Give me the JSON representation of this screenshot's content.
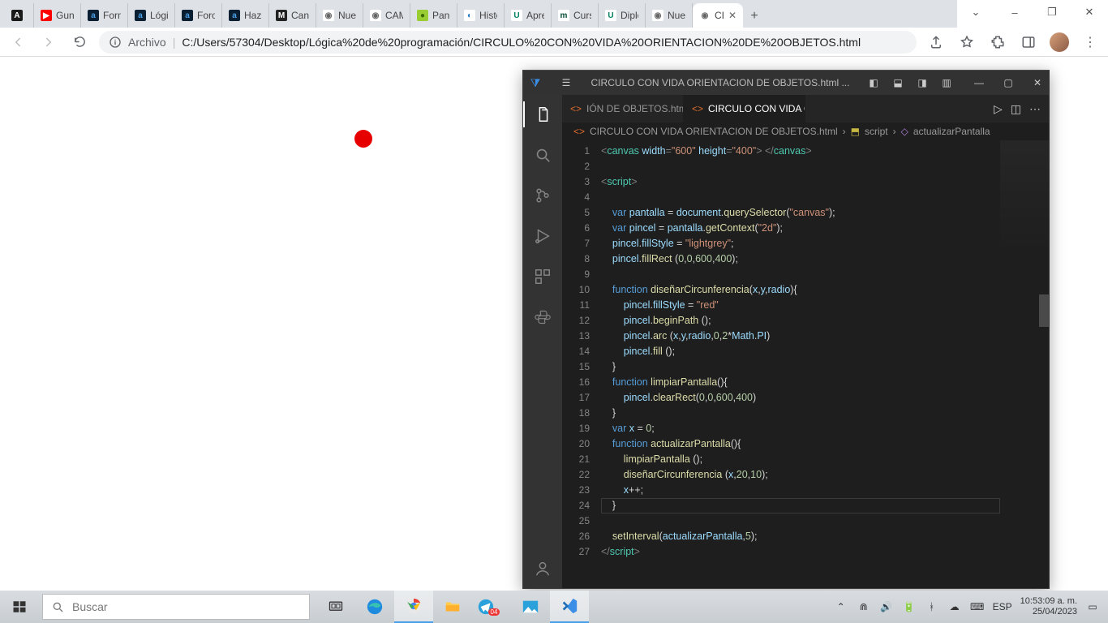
{
  "os_window": {
    "minimize": "–",
    "maximize": "❐",
    "close": "✕"
  },
  "chrome": {
    "tabs": [
      {
        "label": "",
        "favicon_bg": "#1a1a1a",
        "favicon_fg": "#fff",
        "favicon_text": "A"
      },
      {
        "label": "Guns",
        "favicon_bg": "#ff0000",
        "favicon_fg": "#fff",
        "favicon_text": "▶"
      },
      {
        "label": "Form",
        "favicon_bg": "#0b1f33",
        "favicon_fg": "#4aa0e8",
        "favicon_text": "a"
      },
      {
        "label": "Lógic",
        "favicon_bg": "#0b1f33",
        "favicon_fg": "#4aa0e8",
        "favicon_text": "a"
      },
      {
        "label": "Foro",
        "favicon_bg": "#0b1f33",
        "favicon_fg": "#4aa0e8",
        "favicon_text": "a"
      },
      {
        "label": "Haz l",
        "favicon_bg": "#0b1f33",
        "favicon_fg": "#4aa0e8",
        "favicon_text": "a"
      },
      {
        "label": "Canv",
        "favicon_bg": "#222",
        "favicon_fg": "#fff",
        "favicon_text": "M"
      },
      {
        "label": "Nuev",
        "favicon_bg": "#fff",
        "favicon_fg": "#666",
        "favicon_text": "◉"
      },
      {
        "label": "CAM",
        "favicon_bg": "#fff",
        "favicon_fg": "#666",
        "favicon_text": "◉"
      },
      {
        "label": "Pane",
        "favicon_bg": "#9acd32",
        "favicon_fg": "#3a6b00",
        "favicon_text": "●"
      },
      {
        "label": "Histo",
        "favicon_bg": "#fff",
        "favicon_fg": "#1e73be",
        "favicon_text": "◐"
      },
      {
        "label": "Apre",
        "favicon_bg": "#fff",
        "favicon_fg": "#008060",
        "favicon_text": "U"
      },
      {
        "label": "Curs",
        "favicon_bg": "#fff",
        "favicon_fg": "#0b4f3a",
        "favicon_text": "m"
      },
      {
        "label": "Diplo",
        "favicon_bg": "#fff",
        "favicon_fg": "#008060",
        "favicon_text": "U"
      },
      {
        "label": "Nuev",
        "favicon_bg": "#fff",
        "favicon_fg": "#666",
        "favicon_text": "◉"
      },
      {
        "label": "CI",
        "favicon_bg": "#fff",
        "favicon_fg": "#666",
        "favicon_text": "◉",
        "active": true
      }
    ],
    "newtab": "+",
    "toolbar": {
      "file_label": "Archivo",
      "url": "C:/Users/57304/Desktop/Lógica%20de%20programación/CIRCULO%20CON%20VIDA%20ORIENTACION%20DE%20OBJETOS.html"
    }
  },
  "vscode": {
    "title": "CIRCULO CON VIDA ORIENTACION DE OBJETOS.html ...",
    "tabs": [
      {
        "label": "IÓN DE OBJETOS.html",
        "active": false
      },
      {
        "label": "CIRCULO CON VIDA ORIENTACION DE OBJETOS.html",
        "active": true
      }
    ],
    "breadcrumb": {
      "file": "CIRCULO CON VIDA ORIENTACION DE OBJETOS.html",
      "scope1": "script",
      "scope2": "actualizarPantalla"
    },
    "line_start": 1,
    "line_end": 27
  },
  "code_tokens": [
    [
      [
        "t-punc",
        "<"
      ],
      [
        "t-tag",
        "canvas"
      ],
      [
        "t-id",
        " "
      ],
      [
        "t-attr",
        "width"
      ],
      [
        "t-punc",
        "="
      ],
      [
        "t-str",
        "\"600\""
      ],
      [
        "t-id",
        " "
      ],
      [
        "t-attr",
        "height"
      ],
      [
        "t-punc",
        "="
      ],
      [
        "t-str",
        "\"400\""
      ],
      [
        "t-punc",
        "> </"
      ],
      [
        "t-tag",
        "canvas"
      ],
      [
        "t-punc",
        ">"
      ]
    ],
    [],
    [
      [
        "t-punc",
        "<"
      ],
      [
        "t-tag",
        "script"
      ],
      [
        "t-punc",
        ">"
      ]
    ],
    [],
    [
      [
        "t-id",
        "    "
      ],
      [
        "t-kw",
        "var"
      ],
      [
        "t-id",
        " "
      ],
      [
        "t-var",
        "pantalla"
      ],
      [
        "t-id",
        " = "
      ],
      [
        "t-var",
        "document"
      ],
      [
        "t-id",
        "."
      ],
      [
        "t-fn",
        "querySelector"
      ],
      [
        "t-id",
        "("
      ],
      [
        "t-str",
        "\"canvas\""
      ],
      [
        "t-id",
        ");"
      ]
    ],
    [
      [
        "t-id",
        "    "
      ],
      [
        "t-kw",
        "var"
      ],
      [
        "t-id",
        " "
      ],
      [
        "t-var",
        "pincel"
      ],
      [
        "t-id",
        " = "
      ],
      [
        "t-var",
        "pantalla"
      ],
      [
        "t-id",
        "."
      ],
      [
        "t-fn",
        "getContext"
      ],
      [
        "t-id",
        "("
      ],
      [
        "t-str",
        "\"2d\""
      ],
      [
        "t-id",
        ");"
      ]
    ],
    [
      [
        "t-id",
        "    "
      ],
      [
        "t-var",
        "pincel"
      ],
      [
        "t-id",
        "."
      ],
      [
        "t-var",
        "fillStyle"
      ],
      [
        "t-id",
        " = "
      ],
      [
        "t-str",
        "\"lightgrey\""
      ],
      [
        "t-id",
        ";"
      ]
    ],
    [
      [
        "t-id",
        "    "
      ],
      [
        "t-var",
        "pincel"
      ],
      [
        "t-id",
        "."
      ],
      [
        "t-fn",
        "fillRect"
      ],
      [
        "t-id",
        " ("
      ],
      [
        "t-num",
        "0"
      ],
      [
        "t-id",
        ","
      ],
      [
        "t-num",
        "0"
      ],
      [
        "t-id",
        ","
      ],
      [
        "t-num",
        "600"
      ],
      [
        "t-id",
        ","
      ],
      [
        "t-num",
        "400"
      ],
      [
        "t-id",
        ");"
      ]
    ],
    [],
    [
      [
        "t-id",
        "    "
      ],
      [
        "t-kw",
        "function"
      ],
      [
        "t-id",
        " "
      ],
      [
        "t-fn",
        "diseñarCircunferencia"
      ],
      [
        "t-id",
        "("
      ],
      [
        "t-var",
        "x"
      ],
      [
        "t-id",
        ","
      ],
      [
        "t-var",
        "y"
      ],
      [
        "t-id",
        ","
      ],
      [
        "t-var",
        "radio"
      ],
      [
        "t-id",
        "){"
      ]
    ],
    [
      [
        "t-id",
        "        "
      ],
      [
        "t-var",
        "pincel"
      ],
      [
        "t-id",
        "."
      ],
      [
        "t-var",
        "fillStyle"
      ],
      [
        "t-id",
        " = "
      ],
      [
        "t-str",
        "\"red\""
      ]
    ],
    [
      [
        "t-id",
        "        "
      ],
      [
        "t-var",
        "pincel"
      ],
      [
        "t-id",
        "."
      ],
      [
        "t-fn",
        "beginPath"
      ],
      [
        "t-id",
        " ();"
      ]
    ],
    [
      [
        "t-id",
        "        "
      ],
      [
        "t-var",
        "pincel"
      ],
      [
        "t-id",
        "."
      ],
      [
        "t-fn",
        "arc"
      ],
      [
        "t-id",
        " ("
      ],
      [
        "t-var",
        "x"
      ],
      [
        "t-id",
        ","
      ],
      [
        "t-var",
        "y"
      ],
      [
        "t-id",
        ","
      ],
      [
        "t-var",
        "radio"
      ],
      [
        "t-id",
        ","
      ],
      [
        "t-num",
        "0"
      ],
      [
        "t-id",
        ","
      ],
      [
        "t-num",
        "2"
      ],
      [
        "t-id",
        "*"
      ],
      [
        "t-var",
        "Math"
      ],
      [
        "t-id",
        "."
      ],
      [
        "t-var",
        "PI"
      ],
      [
        "t-id",
        ")"
      ]
    ],
    [
      [
        "t-id",
        "        "
      ],
      [
        "t-var",
        "pincel"
      ],
      [
        "t-id",
        "."
      ],
      [
        "t-fn",
        "fill"
      ],
      [
        "t-id",
        " ();"
      ]
    ],
    [
      [
        "t-id",
        "    }"
      ]
    ],
    [
      [
        "t-id",
        "    "
      ],
      [
        "t-kw",
        "function"
      ],
      [
        "t-id",
        " "
      ],
      [
        "t-fn",
        "limpiarPantalla"
      ],
      [
        "t-id",
        "(){"
      ]
    ],
    [
      [
        "t-id",
        "        "
      ],
      [
        "t-var",
        "pincel"
      ],
      [
        "t-id",
        "."
      ],
      [
        "t-fn",
        "clearRect"
      ],
      [
        "t-id",
        "("
      ],
      [
        "t-num",
        "0"
      ],
      [
        "t-id",
        ","
      ],
      [
        "t-num",
        "0"
      ],
      [
        "t-id",
        ","
      ],
      [
        "t-num",
        "600"
      ],
      [
        "t-id",
        ","
      ],
      [
        "t-num",
        "400"
      ],
      [
        "t-id",
        ")"
      ]
    ],
    [
      [
        "t-id",
        "    }"
      ]
    ],
    [
      [
        "t-id",
        "    "
      ],
      [
        "t-kw",
        "var"
      ],
      [
        "t-id",
        " "
      ],
      [
        "t-var",
        "x"
      ],
      [
        "t-id",
        " = "
      ],
      [
        "t-num",
        "0"
      ],
      [
        "t-id",
        ";"
      ]
    ],
    [
      [
        "t-id",
        "    "
      ],
      [
        "t-kw",
        "function"
      ],
      [
        "t-id",
        " "
      ],
      [
        "t-fn",
        "actualizarPantalla"
      ],
      [
        "t-id",
        "(){"
      ]
    ],
    [
      [
        "t-id",
        "        "
      ],
      [
        "t-fn",
        "limpiarPantalla"
      ],
      [
        "t-id",
        " ();"
      ]
    ],
    [
      [
        "t-id",
        "        "
      ],
      [
        "t-fn",
        "diseñarCircunferencia"
      ],
      [
        "t-id",
        " ("
      ],
      [
        "t-var",
        "x"
      ],
      [
        "t-id",
        ","
      ],
      [
        "t-num",
        "20"
      ],
      [
        "t-id",
        ","
      ],
      [
        "t-num",
        "10"
      ],
      [
        "t-id",
        ");"
      ]
    ],
    [
      [
        "t-id",
        "        "
      ],
      [
        "t-var",
        "x"
      ],
      [
        "t-id",
        "++;"
      ]
    ],
    [
      [
        "t-id",
        "    }"
      ]
    ],
    [],
    [
      [
        "t-id",
        "    "
      ],
      [
        "t-fn",
        "setInterval"
      ],
      [
        "t-id",
        "("
      ],
      [
        "t-var",
        "actualizarPantalla"
      ],
      [
        "t-id",
        ","
      ],
      [
        "t-num",
        "5"
      ],
      [
        "t-id",
        ");"
      ]
    ],
    [
      [
        "t-punc",
        "</"
      ],
      [
        "t-tag",
        "script"
      ],
      [
        "t-punc",
        ">"
      ]
    ]
  ],
  "taskbar": {
    "search_placeholder": "Buscar",
    "lang": "ESP",
    "time": "10:53:09 a. m.",
    "date": "25/04/2023"
  }
}
